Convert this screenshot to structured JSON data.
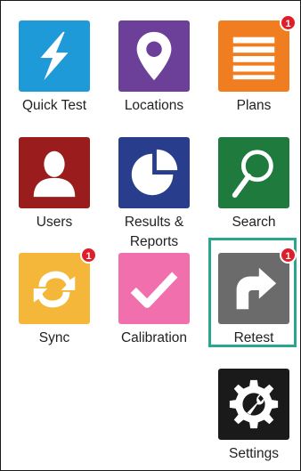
{
  "tiles": {
    "quick_test": {
      "label": "Quick Test",
      "icon": "lightning-icon",
      "color": "#1e9ad8"
    },
    "locations": {
      "label": "Locations",
      "icon": "location-pin-icon",
      "color": "#6c3f99"
    },
    "plans": {
      "label": "Plans",
      "icon": "list-icon",
      "color": "#f07e20",
      "badge": "1"
    },
    "users": {
      "label": "Users",
      "icon": "user-icon",
      "color": "#9b1c1c"
    },
    "results": {
      "label": "Results &",
      "label2": "Reports",
      "icon": "pie-chart-icon",
      "color": "#283d8c"
    },
    "search": {
      "label": "Search",
      "icon": "magnifier-icon",
      "color": "#1f7a3e"
    },
    "sync": {
      "label": "Sync",
      "icon": "sync-icon",
      "color": "#f4b73a",
      "badge": "1"
    },
    "calibration": {
      "label": "Calibration",
      "icon": "checkmark-icon",
      "color": "#f06fac"
    },
    "retest": {
      "label": "Retest",
      "icon": "redo-arrow-icon",
      "color": "#6b6b6b",
      "badge": "1",
      "highlight_color": "#2aa58e"
    },
    "settings": {
      "label": "Settings",
      "icon": "gear-wrench-icon",
      "color": "#1a1a1a"
    }
  },
  "colors": {
    "badge": "#e01e2b",
    "highlight": "#2aa58e"
  }
}
